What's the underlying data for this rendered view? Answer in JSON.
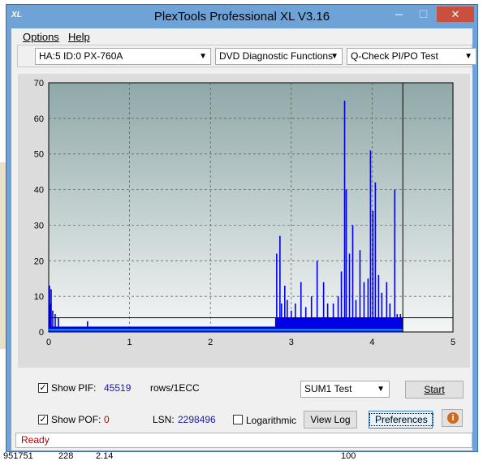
{
  "window": {
    "title": "PlexTools Professional XL V3.16",
    "icon_text": "XL",
    "controls": [
      "─",
      "☐",
      "✕"
    ]
  },
  "menu": {
    "options": "Options",
    "help": "Help"
  },
  "toolbar": {
    "drive": "HA:5 ID:0  PX-760A",
    "function": "DVD Diagnostic Functions",
    "test": "Q-Check PI/PO Test"
  },
  "chart_data": {
    "type": "bar",
    "x_range": [
      0,
      5
    ],
    "y_range": [
      0,
      70
    ],
    "x_ticks": [
      "0",
      "1",
      "2",
      "3",
      "4",
      "5"
    ],
    "y_ticks": [
      "0",
      "10",
      "20",
      "30",
      "40",
      "50",
      "60",
      "70"
    ],
    "grid": true,
    "end_marker_x": 4.38,
    "sum_line_value": 4,
    "series": [
      {
        "color": "#0000e6",
        "x": [
          0.01,
          0.02,
          0.03,
          0.05,
          0.08,
          0.12,
          0.48,
          2.82,
          2.86,
          2.88,
          2.92,
          2.95,
          3.0,
          3.05,
          3.12,
          3.18,
          3.25,
          3.32,
          3.4,
          3.45,
          3.52,
          3.58,
          3.62,
          3.66,
          3.68,
          3.72,
          3.76,
          3.8,
          3.85,
          3.9,
          3.95,
          3.98,
          4.01,
          4.04,
          4.08,
          4.12,
          4.18,
          4.22,
          4.28,
          4.31,
          4.35
        ],
        "values": [
          13,
          8,
          12,
          6,
          5,
          4,
          3,
          22,
          27,
          8,
          13,
          9,
          6,
          8,
          14,
          7,
          10,
          20,
          14,
          8,
          8,
          10,
          17,
          65,
          40,
          22,
          30,
          9,
          23,
          14,
          15,
          51,
          34,
          42,
          16,
          11,
          14,
          8,
          40,
          5,
          5
        ]
      }
    ]
  },
  "controls": {
    "show_pif_label": "Show PIF:",
    "pif_value": "45519",
    "rows_label": "rows/1ECC",
    "show_pof_label": "Show POF:",
    "pof_value": "0",
    "lsn_label": "LSN:",
    "lsn_value": "2298496",
    "logarithmic_label": "Logarithmic",
    "test_select": "SUM1 Test",
    "start_button": "Start",
    "view_log_button": "View Log",
    "preferences_button": "Preferences"
  },
  "status": {
    "text": "Ready"
  },
  "background_row": {
    "c1": "951751",
    "c2": "228",
    "c3": "2.14",
    "c4": "100"
  }
}
